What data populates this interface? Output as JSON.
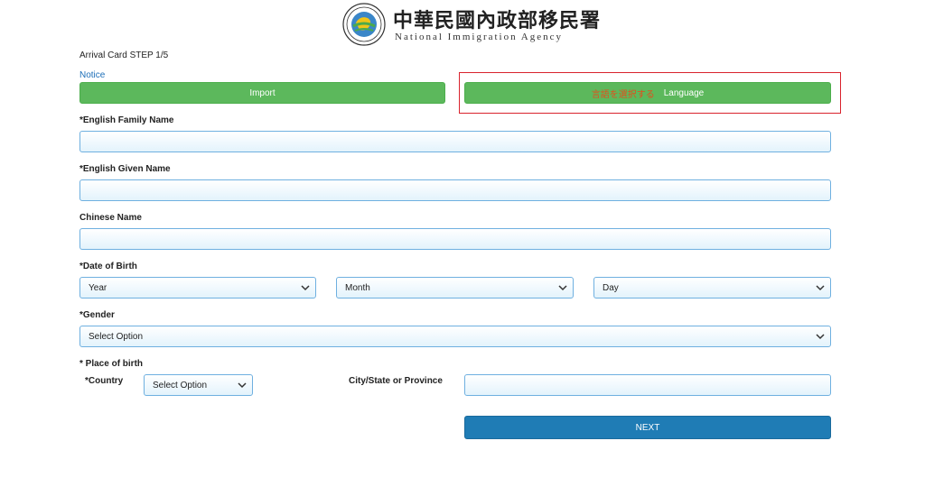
{
  "header": {
    "agency_cn": "中華民國內政部移民署",
    "agency_en": "National Immigration Agency"
  },
  "form": {
    "step": "Arrival Card STEP 1/5",
    "notice": "Notice",
    "import_label": "Import",
    "language_jp": "言語を選択する",
    "language_label": "Language",
    "family_name_label": "*English Family Name",
    "given_name_label": "*English Given Name",
    "chinese_name_label": "Chinese Name",
    "dob_label": "*Date of Birth",
    "year": "Year",
    "month": "Month",
    "day": "Day",
    "gender_label": "*Gender",
    "gender_value": "Select Option",
    "place_label": "* Place of birth",
    "country_label": "*Country",
    "country_value": "Select Option",
    "city_label": "City/State or Province",
    "next_label": "NEXT"
  },
  "colors": {
    "green": "#5cb85c",
    "blue": "#1f7cb5",
    "highlight": "#d9232d",
    "field_border": "#6fb0e0"
  }
}
